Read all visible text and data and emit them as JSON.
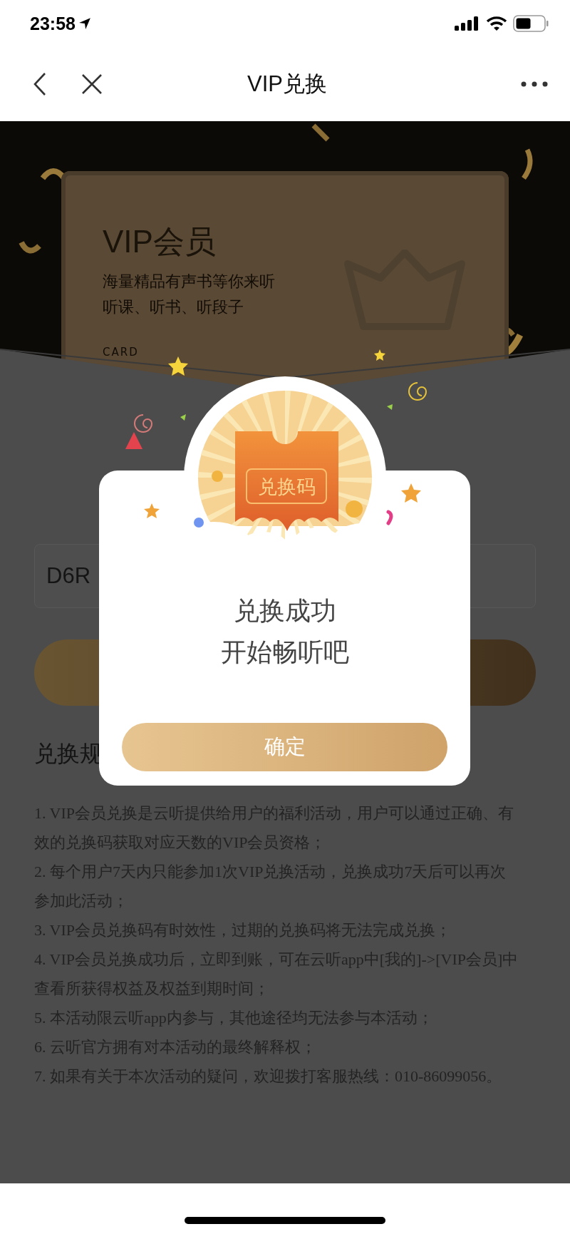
{
  "status_bar": {
    "time": "23:58"
  },
  "nav": {
    "title": "VIP兑换"
  },
  "vip_card": {
    "title": "VIP会员",
    "subtitle_lines": [
      "海量精品有声书等你来听",
      "听课、听书、听段子"
    ],
    "label": "CARD"
  },
  "code_field": {
    "value": "D6R"
  },
  "rules": {
    "heading": "兑换规",
    "items": [
      "1. VIP会员兑换是云听提供给用户的福利活动，用户可以通过正确、有效的兑换码获取对应天数的VIP会员资格；",
      "2. 每个用户7天内只能参加1次VIP兑换活动，兑换成功7天后可以再次参加此活动；",
      "3. VIP会员兑换码有时效性，过期的兑换码将无法完成兑换；",
      "4. VIP会员兑换成功后，立即到账，可在云听app中[我的]->[VIP会员]中查看所获得权益及权益到期时间；",
      "5. 本活动限云听app内参与，其他途径均无法参与本活动；",
      "6. 云听官方拥有对本活动的最终解释权；",
      "7. 如果有关于本次活动的疑问，欢迎拨打客服热线：010-86099056。"
    ]
  },
  "dialog": {
    "badge": "兑换码",
    "message_lines": [
      "兑换成功",
      "开始畅听吧"
    ],
    "button": "确定"
  }
}
